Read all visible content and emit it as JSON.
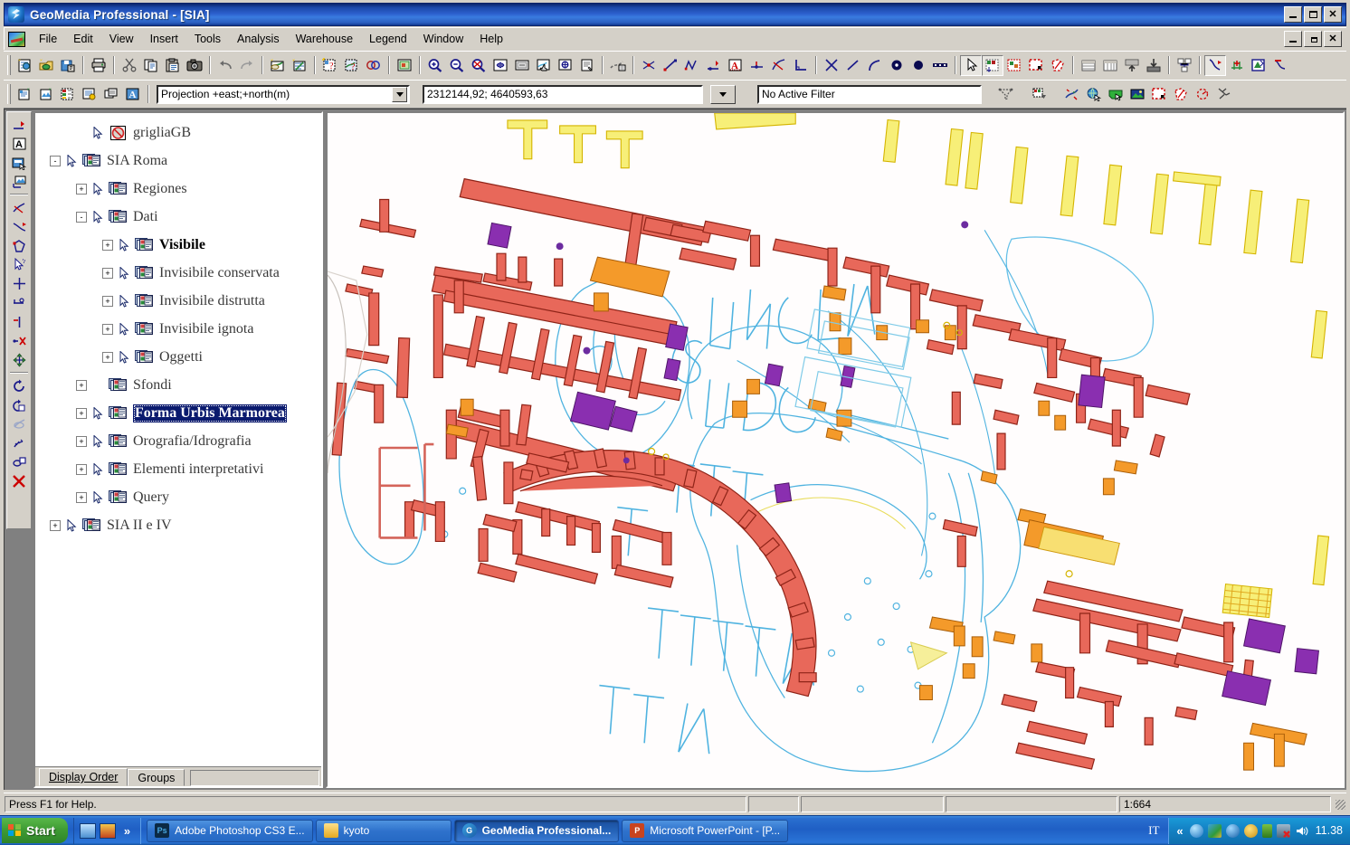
{
  "window": {
    "title": "GeoMedia Professional - [SIA]",
    "app_icon": "geomedia-logo-icon",
    "buttons": {
      "minimize": "minimize-icon",
      "maximize": "maximize-icon",
      "close": "close-icon"
    }
  },
  "menubar": {
    "doc_icon": "map-document-icon",
    "items": [
      "File",
      "Edit",
      "View",
      "Insert",
      "Tools",
      "Analysis",
      "Warehouse",
      "Legend",
      "Window",
      "Help"
    ],
    "mdi_buttons": {
      "minimize": "minimize-icon",
      "restore": "restore-icon",
      "close": "close-icon"
    }
  },
  "toolbar_main": {
    "groups": [
      {
        "buttons": [
          {
            "name": "new-geoworkspace-icon",
            "tip": "New GeoWorkspace"
          },
          {
            "name": "open-warehouse-icon",
            "tip": "Open Warehouse"
          },
          {
            "name": "save-geoworkspace-icon",
            "tip": "Save GeoWorkspace"
          }
        ]
      },
      {
        "buttons": [
          {
            "name": "print-icon",
            "tip": "Print"
          }
        ]
      },
      {
        "buttons": [
          {
            "name": "cut-icon",
            "tip": "Cut"
          },
          {
            "name": "copy-icon",
            "tip": "Copy"
          },
          {
            "name": "paste-icon",
            "tip": "Paste"
          },
          {
            "name": "capture-icon",
            "tip": "Capture"
          }
        ]
      },
      {
        "buttons": [
          {
            "name": "undo-icon",
            "tip": "Undo"
          },
          {
            "name": "redo-icon",
            "tip": "Redo"
          }
        ]
      },
      {
        "buttons": [
          {
            "name": "new-map-window-icon",
            "tip": "New Map Window"
          },
          {
            "name": "new-data-window-icon",
            "tip": "New Data Window"
          }
        ]
      },
      {
        "buttons": [
          {
            "name": "attribute-query-icon",
            "tip": "Attribute Query"
          },
          {
            "name": "spatial-query-icon",
            "tip": "Spatial Query"
          },
          {
            "name": "analytical-merge-icon",
            "tip": "Analytical Merge"
          }
        ]
      },
      {
        "buttons": [
          {
            "name": "fit-all-icon",
            "tip": "Fit All"
          }
        ]
      },
      {
        "buttons": [
          {
            "name": "zoom-in-icon",
            "tip": "Zoom In"
          },
          {
            "name": "zoom-out-icon",
            "tip": "Zoom Out"
          },
          {
            "name": "zoom-to-selection-icon",
            "tip": "Zoom to Selection"
          },
          {
            "name": "fit-window-icon",
            "tip": "Fit Window"
          },
          {
            "name": "previous-view-icon",
            "tip": "Previous View"
          },
          {
            "name": "pan-icon",
            "tip": "Pan"
          },
          {
            "name": "display-properties-icon",
            "tip": "Display Properties"
          },
          {
            "name": "map-properties-icon",
            "tip": "Map Properties"
          }
        ]
      },
      {
        "buttons": [
          {
            "name": "legend-entries-icon",
            "tip": "Legend Entries"
          }
        ]
      },
      {
        "buttons": [
          {
            "name": "insert-intersection-icon",
            "tip": "Insert Intersection Point"
          },
          {
            "name": "insert-line-icon",
            "tip": "Insert Line"
          },
          {
            "name": "insert-polyline-icon",
            "tip": "Insert Polyline"
          },
          {
            "name": "insert-point-icon",
            "tip": "Insert Point"
          },
          {
            "name": "insert-text-icon",
            "tip": "Insert Text"
          },
          {
            "name": "insert-symbol-icon",
            "tip": "Insert Symbol"
          },
          {
            "name": "insert-tangent-icon",
            "tip": "Insert Tangent"
          },
          {
            "name": "insert-perpendicular-icon",
            "tip": "Insert Perpendicular"
          }
        ]
      },
      {
        "buttons": [
          {
            "name": "intersect-icon",
            "tip": "Intersect"
          },
          {
            "name": "segment-icon",
            "tip": "Segment"
          },
          {
            "name": "arc-icon",
            "tip": "Arc"
          },
          {
            "name": "circle-icon",
            "tip": "Circle"
          },
          {
            "name": "filled-circle-icon",
            "tip": "Filled Circle"
          },
          {
            "name": "rectangle-icon",
            "tip": "Rectangle"
          }
        ]
      },
      {
        "buttons": [
          {
            "name": "select-tool-icon",
            "tip": "Select Tool",
            "pressed": true
          },
          {
            "name": "select-by-attribute-icon",
            "tip": "Select by Attribute"
          },
          {
            "name": "select-by-area-icon",
            "tip": "Select by Area"
          },
          {
            "name": "select-fence-icon",
            "tip": "Select Fence"
          },
          {
            "name": "select-polygon-icon",
            "tip": "Select Polygon"
          }
        ]
      },
      {
        "buttons": [
          {
            "name": "data-table-icon",
            "tip": "Data Table"
          },
          {
            "name": "data-columns-icon",
            "tip": "Data Columns"
          },
          {
            "name": "export-table-icon",
            "tip": "Export"
          },
          {
            "name": "import-table-icon",
            "tip": "Import"
          },
          {
            "name": "join-table-icon",
            "tip": "Join"
          }
        ]
      },
      {
        "buttons": [
          {
            "name": "edit-geometry-icon",
            "tip": "Edit Geometry",
            "pressed": true
          },
          {
            "name": "add-vertex-icon",
            "tip": "Add Vertex"
          },
          {
            "name": "move-geometry-icon",
            "tip": "Move Geometry"
          },
          {
            "name": "delete-geometry-icon",
            "tip": "Delete Geometry"
          }
        ]
      }
    ]
  },
  "toolbar_second": {
    "left_buttons": [
      {
        "name": "new-feature-class-icon",
        "tip": "New Feature Class"
      },
      {
        "name": "new-style-icon",
        "tip": "New Style"
      },
      {
        "name": "thematic-legend-icon",
        "tip": "Thematic Legend"
      },
      {
        "name": "legend-properties-icon",
        "tip": "Legend Properties"
      },
      {
        "name": "layer-control-icon",
        "tip": "Layer Control"
      },
      {
        "name": "label-features-icon",
        "tip": "Label Features"
      }
    ],
    "projection": {
      "name": "projection-combo",
      "value": "Projection +east;+north(m)",
      "placeholder": "Projection"
    },
    "coordinates": {
      "name": "coordinate-readout",
      "value": "2312144,92; 4640593,63",
      "placeholder": ""
    },
    "coord_dropdown": "coordinate-dropdown-button",
    "filter": {
      "name": "active-filter-field",
      "value": "No Active Filter",
      "placeholder": "No Active Filter"
    },
    "right_buttons": [
      {
        "name": "filter-settings-icon",
        "tip": "Filter Settings"
      },
      {
        "name": "apply-filter-icon",
        "tip": "Apply Filter"
      },
      {
        "name": "locate-feature-icon",
        "tip": "Locate Feature"
      },
      {
        "name": "globe-select-icon",
        "tip": "Globe Select"
      },
      {
        "name": "map-select-icon",
        "tip": "Map Select"
      },
      {
        "name": "image-layer-icon",
        "tip": "Image Layer"
      },
      {
        "name": "fence-select-icon",
        "tip": "Fence Select"
      },
      {
        "name": "polygon-select-icon",
        "tip": "Polygon Select"
      },
      {
        "name": "radius-select-icon",
        "tip": "Radius Select"
      },
      {
        "name": "clear-selection-icon",
        "tip": "Clear Selection"
      }
    ]
  },
  "vertical_toolbar": {
    "buttons": [
      {
        "name": "insert-point-tool-icon",
        "tip": "Insert Point"
      },
      {
        "name": "insert-text-tool-icon",
        "tip": "Insert Text"
      },
      {
        "name": "edit-text-tool-icon",
        "tip": "Edit Text"
      },
      {
        "name": "place-image-tool-icon",
        "tip": "Place Image"
      },
      {
        "sep": true
      },
      {
        "name": "tangent-tool-icon",
        "tip": "Tangent"
      },
      {
        "name": "arc-tool-icon",
        "tip": "Arc"
      },
      {
        "name": "polygon-tool-icon",
        "tip": "Polygon"
      },
      {
        "name": "pick-point-tool-icon",
        "tip": "Pick Point"
      },
      {
        "name": "crosshair-tool-icon",
        "tip": "Crosshair"
      },
      {
        "name": "offset-tool-icon",
        "tip": "Offset"
      },
      {
        "name": "trim-tool-icon",
        "tip": "Trim"
      },
      {
        "name": "delete-vertex-tool-icon",
        "tip": "Delete Vertex"
      },
      {
        "name": "move-tool-icon",
        "tip": "Move"
      },
      {
        "sep": true
      },
      {
        "name": "rotate-tool-icon",
        "tip": "Rotate"
      },
      {
        "name": "rotate-copy-tool-icon",
        "tip": "Rotate Copy"
      },
      {
        "name": "mirror-tool-icon",
        "tip": "Mirror"
      },
      {
        "name": "scale-tool-icon",
        "tip": "Scale"
      },
      {
        "name": "copy-parallel-tool-icon",
        "tip": "Copy Parallel"
      },
      {
        "name": "delete-tool-icon",
        "tip": "Delete"
      }
    ]
  },
  "legend": {
    "tabs": [
      {
        "label": "Display Order",
        "active": true
      },
      {
        "label": "Groups",
        "active": false
      }
    ],
    "tree": [
      {
        "label": "grigliaGB",
        "indent": 1,
        "expander": "",
        "pointer": true,
        "icon": "disabled-layer-icon",
        "bold": false,
        "selected": false
      },
      {
        "label": "SIA Roma",
        "indent": 0,
        "expander": "-",
        "pointer": true,
        "icon": "layer-group-icon",
        "bold": false,
        "selected": false
      },
      {
        "label": "Regiones",
        "indent": 1,
        "expander": "+",
        "pointer": true,
        "icon": "layer-group-icon",
        "bold": false,
        "selected": false
      },
      {
        "label": "Dati",
        "indent": 1,
        "expander": "-",
        "pointer": true,
        "icon": "layer-group-icon",
        "bold": false,
        "selected": false
      },
      {
        "label": "Visibile",
        "indent": 2,
        "expander": "+",
        "pointer": true,
        "icon": "layer-group-icon",
        "bold": true,
        "selected": false
      },
      {
        "label": "Invisibile conservata",
        "indent": 2,
        "expander": "+",
        "pointer": true,
        "icon": "layer-group-icon",
        "bold": false,
        "selected": false
      },
      {
        "label": "Invisibile distrutta",
        "indent": 2,
        "expander": "+",
        "pointer": true,
        "icon": "layer-group-icon",
        "bold": false,
        "selected": false
      },
      {
        "label": "Invisibile ignota",
        "indent": 2,
        "expander": "+",
        "pointer": true,
        "icon": "layer-group-icon",
        "bold": false,
        "selected": false
      },
      {
        "label": "Oggetti",
        "indent": 2,
        "expander": "+",
        "pointer": true,
        "icon": "layer-group-icon",
        "bold": false,
        "selected": false
      },
      {
        "label": "Sfondi",
        "indent": 1,
        "expander": "+",
        "pointer": false,
        "icon": "layer-group-icon",
        "bold": false,
        "selected": false
      },
      {
        "label": "Forma Urbis Marmorea",
        "indent": 1,
        "expander": "+",
        "pointer": true,
        "icon": "layer-group-icon",
        "bold": false,
        "selected": true
      },
      {
        "label": "Orografia/Idrografia",
        "indent": 1,
        "expander": "+",
        "pointer": true,
        "icon": "layer-group-icon",
        "bold": false,
        "selected": false
      },
      {
        "label": "Elementi interpretativi",
        "indent": 1,
        "expander": "+",
        "pointer": true,
        "icon": "layer-group-icon",
        "bold": false,
        "selected": false
      },
      {
        "label": "Query",
        "indent": 1,
        "expander": "+",
        "pointer": true,
        "icon": "layer-group-icon",
        "bold": false,
        "selected": false
      },
      {
        "label": "SIA II e IV",
        "indent": 0,
        "expander": "+",
        "pointer": true,
        "icon": "layer-group-icon",
        "bold": false,
        "selected": false
      }
    ]
  },
  "map": {
    "name": "map-view",
    "inscription_fragments": [
      "MAGN",
      "DVS"
    ],
    "colors": {
      "wall_red": "#e8685a",
      "wall_red_stroke": "#8f2418",
      "orange": "#f49a2a",
      "orange_light": "#f9bd55",
      "yellow": "#f6e96a",
      "yellow_stroke": "#d4b400",
      "purple": "#8a2fb0",
      "violet": "#6c2ca0",
      "outline_blue": "#4fb3e0",
      "outline_blue_dark": "#2d7fae",
      "background": "#fffdfd"
    }
  },
  "statusbar": {
    "hint": "Press F1 for Help.",
    "panes": [
      "",
      "",
      "",
      ""
    ],
    "scale": "1:664",
    "resize_grip": "resize-grip-icon"
  },
  "taskbar": {
    "start_label": "Start",
    "start_icon": "windows-flag-icon",
    "quicklaunch": [
      {
        "name": "show-desktop-icon"
      },
      {
        "name": "quicklaunch-app-icon"
      }
    ],
    "chevron": "»",
    "tasks": [
      {
        "label": "Adobe Photoshop CS3 E...",
        "icon": "photoshop-icon",
        "active": false
      },
      {
        "label": "kyoto",
        "icon": "folder-icon",
        "active": false
      },
      {
        "label": "GeoMedia Professional...",
        "icon": "geomedia-icon",
        "active": true
      },
      {
        "label": "Microsoft PowerPoint - [P...",
        "icon": "powerpoint-icon",
        "active": false
      }
    ],
    "language": "IT",
    "tray_chevron": "«",
    "tray_icons": [
      {
        "name": "messenger-tray-icon"
      },
      {
        "name": "geomedia-tray-icon"
      },
      {
        "name": "internet-tray-icon"
      },
      {
        "name": "security-tray-icon"
      },
      {
        "name": "battery-tray-icon"
      },
      {
        "name": "network-disconnected-tray-icon"
      },
      {
        "name": "volume-tray-icon"
      }
    ],
    "clock": "11.38"
  }
}
